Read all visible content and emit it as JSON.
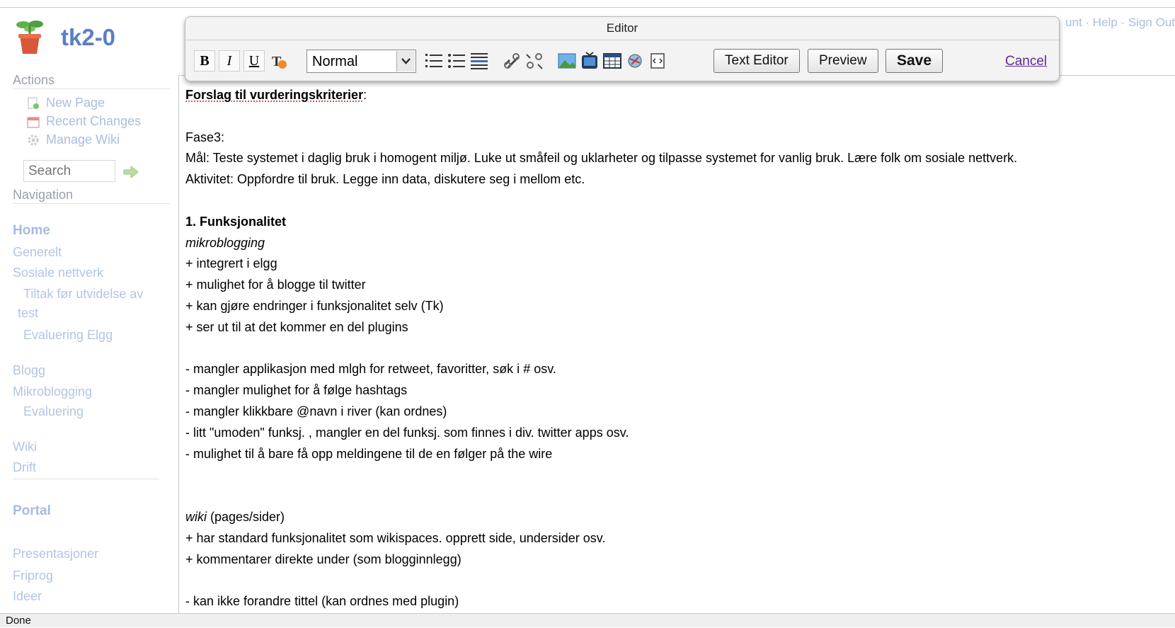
{
  "site": {
    "title": "tk2-0"
  },
  "actions": {
    "heading": "Actions",
    "new_page": "New Page",
    "recent_changes": "Recent Changes",
    "manage_wiki": "Manage Wiki",
    "search_placeholder": "Search"
  },
  "navigation": {
    "heading": "Navigation",
    "items": [
      "Home",
      "Generelt",
      "Sosiale nettverk",
      "Tiltak før utvidelse av",
      "test",
      "Evaluering Elgg",
      "Blogg",
      "Mikroblogging",
      "Evaluering",
      "Wiki",
      "Drift",
      "Portal",
      "Presentasjoner",
      "Friprog",
      "Ideer"
    ]
  },
  "top_links": "unt · Help · Sign Out",
  "editor": {
    "title": "Editor",
    "format_value": "Normal",
    "text_editor": "Text Editor",
    "preview": "Preview",
    "save": "Save",
    "cancel": "Cancel"
  },
  "content": {
    "l1": "Forslag til vurderingskriterier",
    "l1b": ":",
    "fase": "Fase3:",
    "mal": "Mål: Teste systemet i daglig bruk i homogent miljø. Luke ut småfeil og uklarheter og tilpasse systemet for vanlig bruk. Lære folk om sosiale nettverk.",
    "aktivitet": "Aktivitet: Oppfordre til bruk. Legge inn data, diskutere seg i mellom etc.",
    "h1": "1. Funksjonalitet",
    "mikro": "mikroblogging",
    "p1": "+ integrert i elgg",
    "p2": "+ mulighet for å blogge til twitter",
    "p3": "+ kan gjøre endringer i funksjonalitet selv (Tk)",
    "p4": "+ ser ut til at det kommer en del plugins",
    "m1": "- mangler applikasjon med mlgh for retweet, favoritter, søk i # osv.",
    "m2": "- mangler mulighet for å følge hashtags",
    "m3": "- mangler klikkbare @navn i river (kan ordnes)",
    "m4": "- litt \"umoden\" funksj. , mangler en del funksj. som finnes i div. twitter apps osv.",
    "m5": "- mulighet til å bare få opp meldingene til de en følger på the wire",
    "wiki": "wiki",
    "wiki_rest": " (pages/sider)",
    "w1": "+ har standard funksjonalitet som wikispaces. opprett side, undersider osv.",
    "w2": "+ kommentarer direkte under (som blogginnlegg)",
    "w3": "- kan ikke forandre tittel (kan ordnes med plugin)"
  },
  "status": "Done"
}
